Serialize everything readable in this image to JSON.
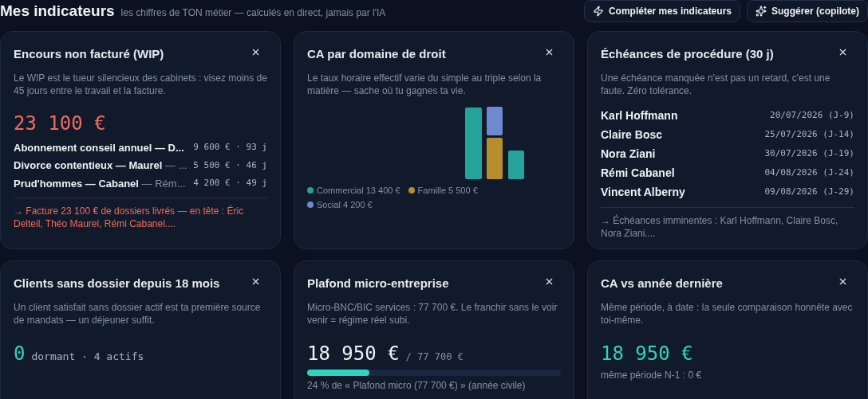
{
  "header": {
    "title": "Mes indicateurs",
    "subtitle": "les chiffres de TON métier — calculés en direct, jamais par l'IA",
    "buttons": [
      {
        "label": "Compléter mes indicateurs"
      },
      {
        "label": "Suggérer (copilote)"
      }
    ]
  },
  "cards": [
    {
      "kind": "wip",
      "title": "Encours non facturé (WIP)",
      "description": "Le WIP est le tueur silencieux des cabinets : visez moins de 45 jours entre le travail et la facture.",
      "value": "23 100 €",
      "rows": [
        {
          "label": "Abonnement conseil annuel — D...",
          "suffix": "",
          "amount": "9 600 € · 93 j"
        },
        {
          "label": "Divorce contentieux — Maurel",
          "suffix": "— ...",
          "amount": "5 500 € · 46 j"
        },
        {
          "label": "Prud'hommes — Cabanel",
          "suffix": "— Rém...",
          "amount": "4 200 € · 49 j"
        }
      ],
      "footer": "→ Facture 23 100 € de dossiers livrés — en tête : Éric Delteil, Théo Maurel, Rémi Cabanel...."
    },
    {
      "kind": "chart",
      "title": "CA par domaine de droit",
      "description": "Le taux horaire effectif varie du simple au triple selon la matière — sache où tu gagnes ta vie.",
      "legend": [
        {
          "label": "Commercial 13 400 €",
          "color": "#24a39a"
        },
        {
          "label": "Famille 5 500 €",
          "color": "#b88d2e"
        },
        {
          "label": "Social 4 200 €",
          "color": "#6d8ad0"
        }
      ]
    },
    {
      "kind": "deadlines",
      "title": "Échéances de procédure (30 j)",
      "description": "Une échéance manquée n'est pas un retard, c'est une faute. Zéro tolérance.",
      "rows": [
        {
          "label": "Karl Hoffmann",
          "date": "20/07/2026 (J-9)"
        },
        {
          "label": "Claire Bosc",
          "date": "25/07/2026 (J-14)"
        },
        {
          "label": "Nora Ziani",
          "date": "30/07/2026 (J-19)"
        },
        {
          "label": "Rémi Cabanel",
          "date": "04/08/2026 (J-24)"
        },
        {
          "label": "Vincent Alberny",
          "date": "09/08/2026 (J-29)"
        }
      ],
      "footer": "→ Échéances imminentes : Karl Hoffmann, Claire Bosc, Nora Ziani...."
    },
    {
      "kind": "count",
      "title": "Clients sans dossier depuis 18 mois",
      "description": "Un client satisfait sans dossier actif est ta première source de mandats — un déjeuner suffit.",
      "value": "0",
      "detail": "dormant · 4 actifs"
    },
    {
      "kind": "progress",
      "title": "Plafond micro-entreprise",
      "description": "Micro-BNC/BIC services : 77 700 €. Le franchir sans le voir venir = régime réel subi.",
      "value": "18 950 €",
      "limit": "/ 77 700 €",
      "level": 0.244,
      "caption": "24 % de « Plafond micro (77 700 €) » (année civile)"
    },
    {
      "kind": "compare",
      "title": "CA vs année dernière",
      "description": "Même période, à date : la seule comparaison honnête avec toi-même.",
      "value": "18 950 €",
      "caption": "même période N-1 : 0 €"
    }
  ]
}
